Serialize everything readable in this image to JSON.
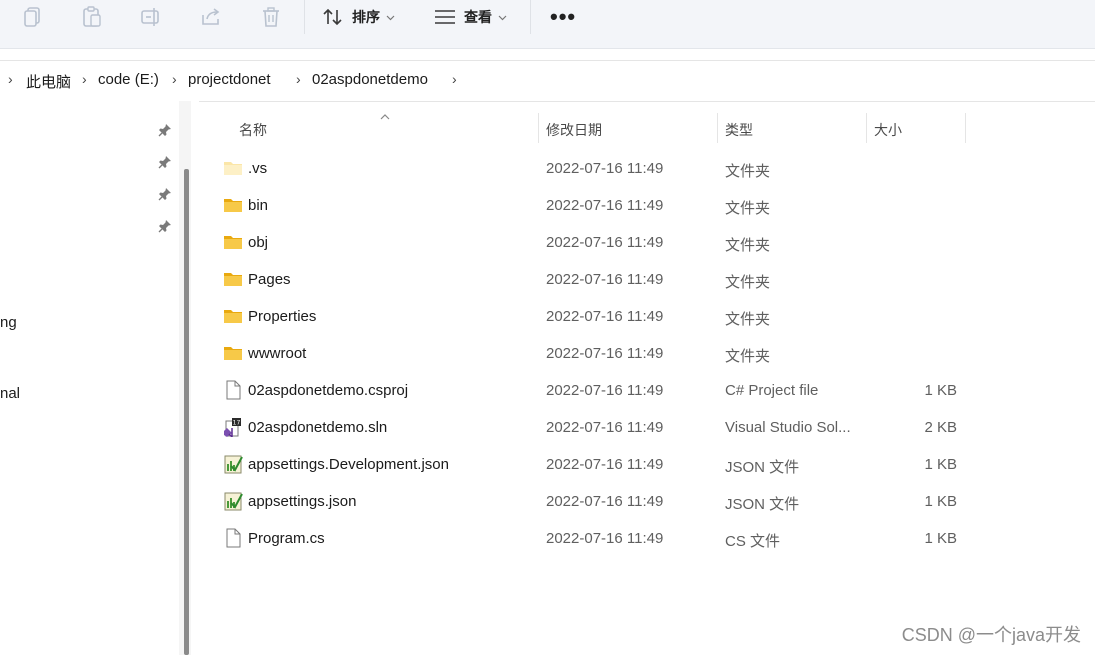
{
  "toolbar": {
    "sort_label": "排序",
    "view_label": "查看",
    "more_label": "•••"
  },
  "breadcrumb": [
    "此电脑",
    "code (E:)",
    "projectdonet",
    "02aspdonetdemo"
  ],
  "nav_fragments": [
    "ng",
    "nal"
  ],
  "columns": {
    "name": "名称",
    "modified": "修改日期",
    "type": "类型",
    "size": "大小"
  },
  "files": [
    {
      "name": ".vs",
      "date": "2022-07-16 11:49",
      "type": "文件夹",
      "size": "",
      "icon": "folder-light-icon"
    },
    {
      "name": "bin",
      "date": "2022-07-16 11:49",
      "type": "文件夹",
      "size": "",
      "icon": "folder-icon"
    },
    {
      "name": "obj",
      "date": "2022-07-16 11:49",
      "type": "文件夹",
      "size": "",
      "icon": "folder-icon"
    },
    {
      "name": "Pages",
      "date": "2022-07-16 11:49",
      "type": "文件夹",
      "size": "",
      "icon": "folder-icon"
    },
    {
      "name": "Properties",
      "date": "2022-07-16 11:49",
      "type": "文件夹",
      "size": "",
      "icon": "folder-icon"
    },
    {
      "name": "wwwroot",
      "date": "2022-07-16 11:49",
      "type": "文件夹",
      "size": "",
      "icon": "folder-icon"
    },
    {
      "name": "02aspdonetdemo.csproj",
      "date": "2022-07-16 11:49",
      "type": "C# Project file",
      "size": "1 KB",
      "icon": "blank-file-icon"
    },
    {
      "name": "02aspdonetdemo.sln",
      "date": "2022-07-16 11:49",
      "type": "Visual Studio Sol...",
      "size": "2 KB",
      "icon": "visual-studio-solution-icon"
    },
    {
      "name": "appsettings.Development.json",
      "date": "2022-07-16 11:49",
      "type": "JSON 文件",
      "size": "1 KB",
      "icon": "json-file-icon"
    },
    {
      "name": "appsettings.json",
      "date": "2022-07-16 11:49",
      "type": "JSON 文件",
      "size": "1 KB",
      "icon": "json-file-icon"
    },
    {
      "name": "Program.cs",
      "date": "2022-07-16 11:49",
      "type": "CS 文件",
      "size": "1 KB",
      "icon": "blank-file-icon"
    }
  ],
  "watermark": "CSDN @一个java开发",
  "colors": {
    "toolbar_bg": "#f3f5f9",
    "folder_yellow": "#f4c542",
    "secondary_text": "#5f5f5f"
  }
}
